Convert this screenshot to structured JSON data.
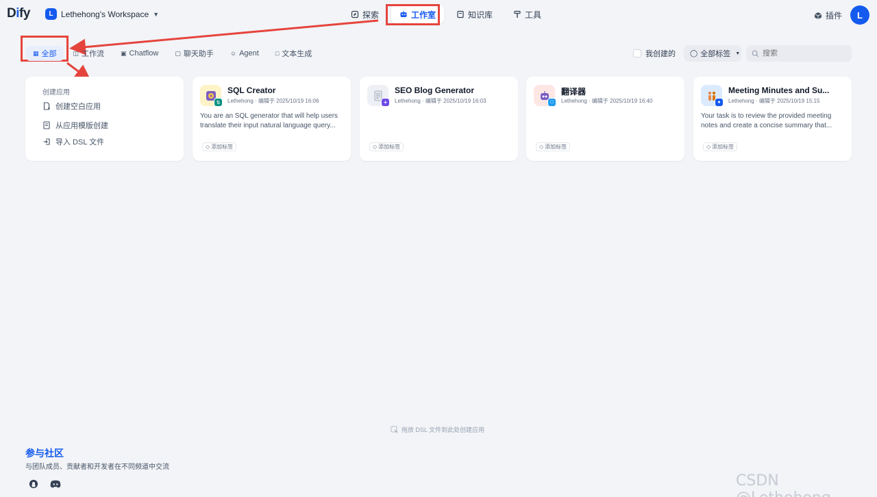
{
  "header": {
    "logo": {
      "part1": "D",
      "part2": "i",
      "part3": "fy"
    },
    "workspace": {
      "initial": "L",
      "name": "Lethehong's Workspace"
    },
    "nav": [
      {
        "label": "探索",
        "icon": "compass-icon"
      },
      {
        "label": "工作室",
        "icon": "robot-icon",
        "active": true
      },
      {
        "label": "知识库",
        "icon": "book-icon"
      },
      {
        "label": "工具",
        "icon": "hammer-icon"
      }
    ],
    "plugin_label": "插件",
    "user_initial": "L"
  },
  "tabs": [
    {
      "label": "全部",
      "icon": "grid-icon",
      "active": true
    },
    {
      "label": "工作流",
      "icon": "workflow-icon"
    },
    {
      "label": "Chatflow",
      "icon": "chatflow-icon"
    },
    {
      "label": "聊天助手",
      "icon": "chat-icon"
    },
    {
      "label": "Agent",
      "icon": "agent-icon"
    },
    {
      "label": "文本生成",
      "icon": "doc-icon"
    }
  ],
  "filters": {
    "mine_label": "我创建的",
    "tags_label": "全部标签",
    "search_placeholder": "搜索"
  },
  "create": {
    "title": "创建应用",
    "items": [
      {
        "label": "创建空白应用",
        "icon": "new-file-icon"
      },
      {
        "label": "从应用模版创建",
        "icon": "template-icon"
      },
      {
        "label": "导入 DSL 文件",
        "icon": "import-icon"
      }
    ]
  },
  "apps": [
    {
      "name": "SQL Creator",
      "meta": "Lethehong · 编辑于 2025/10/19 16:06",
      "desc": "You are an SQL generator that will help users translate their input natural language query...",
      "tag": "添加标签",
      "icon": "database-icon",
      "badge": "workflow-badge-icon"
    },
    {
      "name": "SEO Blog Generator",
      "meta": "Lethehong · 编辑于 2025/10/19 16:03",
      "desc": "",
      "tag": "添加标签",
      "icon": "document-icon",
      "badge": "agent-badge-icon"
    },
    {
      "name": "翻译器",
      "meta": "Lethehong · 编辑于 2025/10/19 16:40",
      "desc": "",
      "tag": "添加标签",
      "icon": "robot-icon",
      "badge": "chat-badge-icon"
    },
    {
      "name": "Meeting Minutes and Su...",
      "meta": "Lethehong · 编辑于 2025/10/19 15:15",
      "desc": "Your task is to review the provided meeting notes and create a concise summary that...",
      "tag": "添加标签",
      "icon": "people-icon",
      "badge": "chatbot-badge-icon"
    }
  ],
  "drop_hint": "拖放 DSL 文件到此处创建应用",
  "community": {
    "title": "参与社区",
    "desc": "与团队成员、贡献者和开发者在不同频道中交流"
  },
  "watermark": "CSDN @Lethehong",
  "colors": {
    "accent": "#155aef",
    "annotation": "#e5443d",
    "background": "#f2f4f7"
  }
}
